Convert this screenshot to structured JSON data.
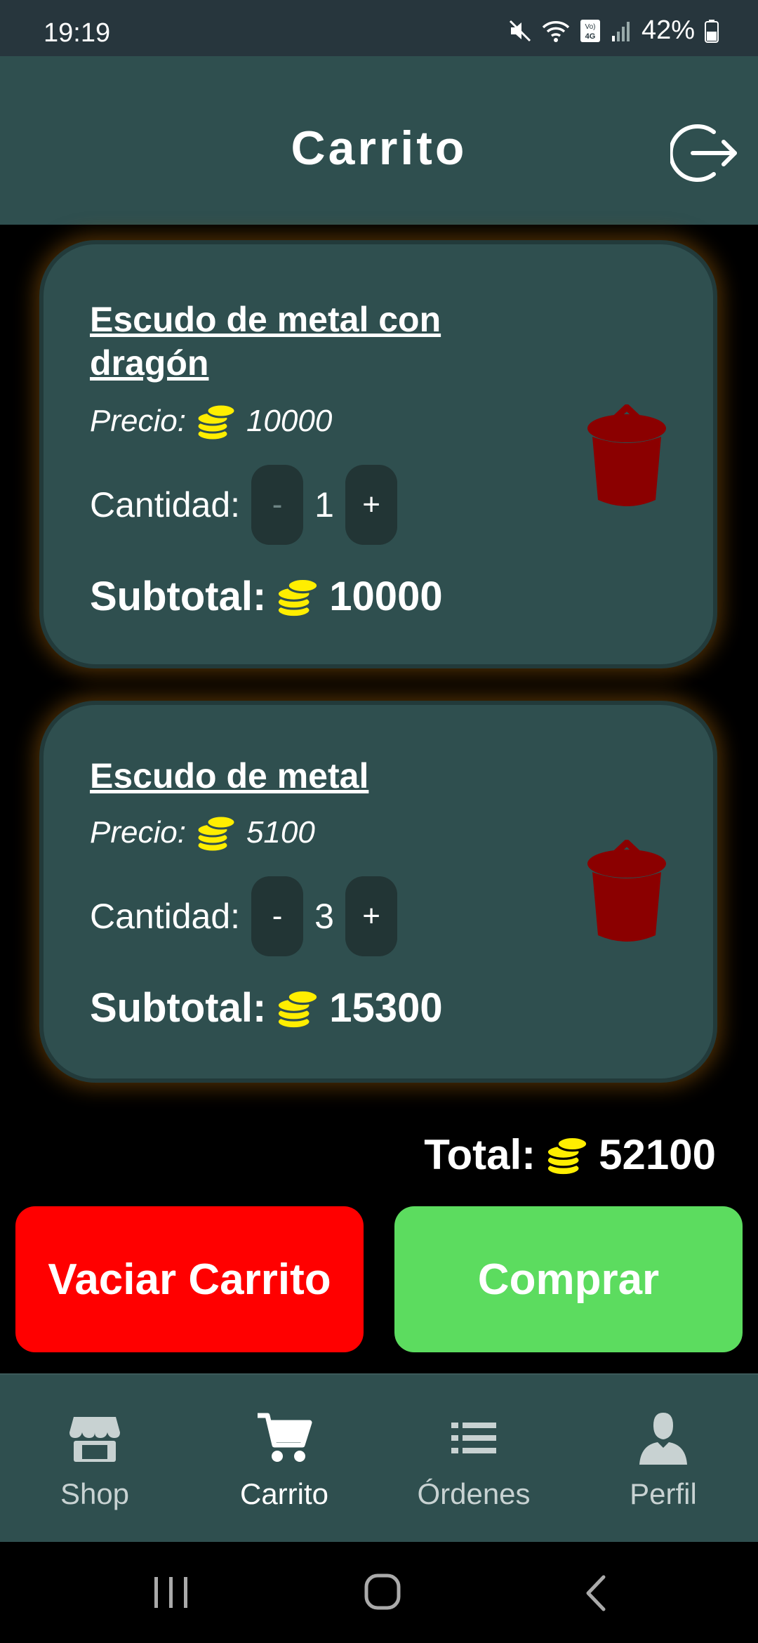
{
  "status_bar": {
    "time": "19:19",
    "battery": "42%",
    "network": "Vo) 4G"
  },
  "header": {
    "title": "Carrito"
  },
  "cart": {
    "items": [
      {
        "name": "Escudo de metal con dragón",
        "price_label": "Precio:",
        "price": "10000",
        "qty_label": "Cantidad:",
        "minus": "-",
        "qty": "1",
        "plus": "+",
        "subtotal_label": "Subtotal:",
        "subtotal": "10000"
      },
      {
        "name": "Escudo de metal",
        "price_label": "Precio:",
        "price": "5100",
        "qty_label": "Cantidad:",
        "minus": "-",
        "qty": "3",
        "plus": "+",
        "subtotal_label": "Subtotal:",
        "subtotal": "15300"
      }
    ],
    "total_label": "Total:",
    "total": "52100"
  },
  "actions": {
    "empty_label": "Vaciar Carrito",
    "buy_label": "Comprar"
  },
  "nav": {
    "items": [
      {
        "label": "Shop",
        "icon": "store-icon"
      },
      {
        "label": "Carrito",
        "icon": "cart-icon",
        "active": true
      },
      {
        "label": "Órdenes",
        "icon": "list-icon"
      },
      {
        "label": "Perfil",
        "icon": "user-icon"
      }
    ]
  },
  "colors": {
    "surface": "#2f4f4f",
    "danger": "#ff0000",
    "success": "#5cdc5f",
    "coin": "#ffee00",
    "trash": "#8b0000"
  }
}
